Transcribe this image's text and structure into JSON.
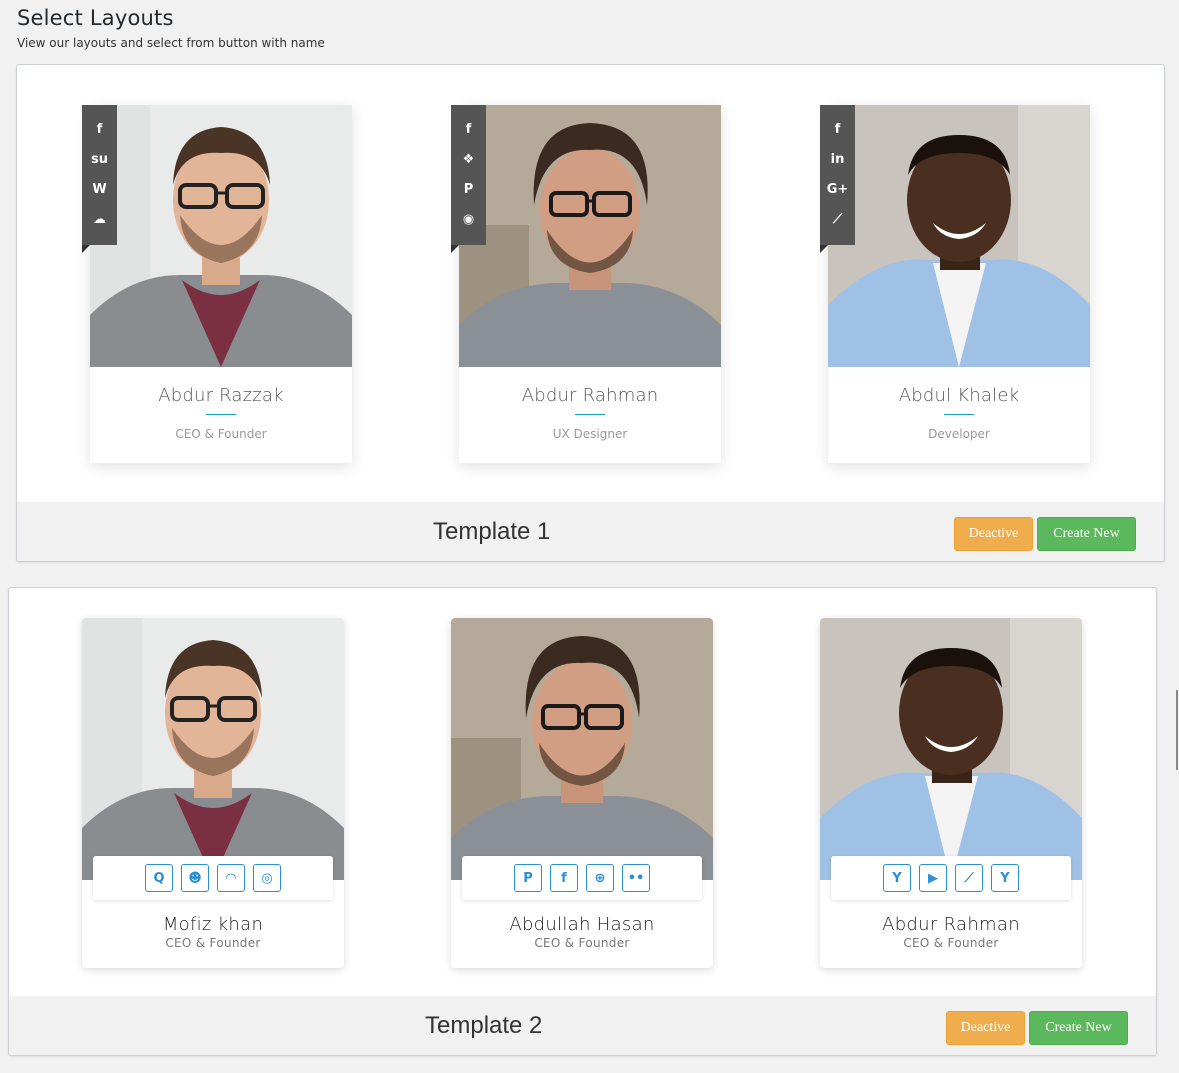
{
  "page": {
    "title": "Select Layouts",
    "subtitle": "View our layouts and select from button with name"
  },
  "template1": {
    "name": "Template 1",
    "deactive_label": "Deactive",
    "create_label": "Create New",
    "members": [
      {
        "name": "Abdur Razzak",
        "role": "CEO & Founder",
        "icons": [
          "facebook-icon",
          "stumbleupon-icon",
          "wordpress-icon",
          "soundcloud-icon"
        ],
        "glyphs": [
          "f",
          "su",
          "W",
          "☁"
        ]
      },
      {
        "name": "Abdur Rahman",
        "role": "UX Designer",
        "icons": [
          "facebook-icon",
          "dropbox-icon",
          "pinterest-icon",
          "compass-icon"
        ],
        "glyphs": [
          "f",
          "❖",
          "P",
          "◉"
        ]
      },
      {
        "name": "Abdul Khalek",
        "role": "Developer",
        "icons": [
          "facebook-icon",
          "linkedin-icon",
          "google-plus-icon",
          "line-chart-icon"
        ],
        "glyphs": [
          "f",
          "in",
          "G+",
          "⟋"
        ]
      }
    ]
  },
  "template2": {
    "name": "Template 2",
    "deactive_label": "Deactive",
    "create_label": "Create New",
    "members": [
      {
        "name": "Mofiz khan",
        "role": "CEO & Founder",
        "icons": [
          "quora-icon",
          "reddit-icon",
          "rss-icon",
          "instagram-icon"
        ],
        "glyphs": [
          "Q",
          "☻",
          "◠",
          "◎"
        ]
      },
      {
        "name": "Abdullah Hasan",
        "role": "CEO & Founder",
        "icons": [
          "paypal-icon",
          "facebook-icon",
          "dribbble-icon",
          "flickr-icon"
        ],
        "glyphs": [
          "P",
          "f",
          "⊕",
          "••"
        ]
      },
      {
        "name": "Abdur Rahman",
        "role": "CEO & Founder",
        "icons": [
          "yahoo-icon",
          "youtube-icon",
          "line-chart-icon",
          "y-combinator-icon"
        ],
        "glyphs": [
          "Y",
          "▶",
          "⟋",
          "Y"
        ]
      }
    ]
  }
}
